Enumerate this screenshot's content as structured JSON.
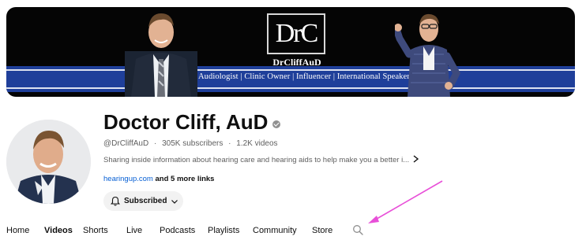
{
  "banner": {
    "logo_mark": "DrC",
    "logo_text": "DrCliffAuD",
    "tagline": "Audiologist | Clinic Owner | Influencer | International Speaker"
  },
  "channel": {
    "name": "Doctor Cliff, AuD",
    "handle": "@DrCliffAuD",
    "subscribers": "305K subscribers",
    "videos": "1.2K videos",
    "separator": "·",
    "description": "Sharing inside information about hearing care and hearing aids to help make you a better i...",
    "link_site": "hearingup.com",
    "link_more": "and 5 more links",
    "subscribe_label": "Subscribed"
  },
  "tabs": [
    {
      "label": "Home"
    },
    {
      "label": "Videos"
    },
    {
      "label": "Shorts"
    },
    {
      "label": "Live"
    },
    {
      "label": "Podcasts"
    },
    {
      "label": "Playlists"
    },
    {
      "label": "Community"
    },
    {
      "label": "Store"
    }
  ],
  "icons": {
    "verified": "verified-badge-icon",
    "chevron": "chevron-right-icon",
    "bell": "bell-icon",
    "dropdown": "chevron-down-icon",
    "search": "search-icon"
  },
  "colors": {
    "banner_bg": "#050505",
    "banner_stripe": "#1f3f9a",
    "link_blue": "#065fd4",
    "annotation_arrow": "#e84fd8"
  }
}
